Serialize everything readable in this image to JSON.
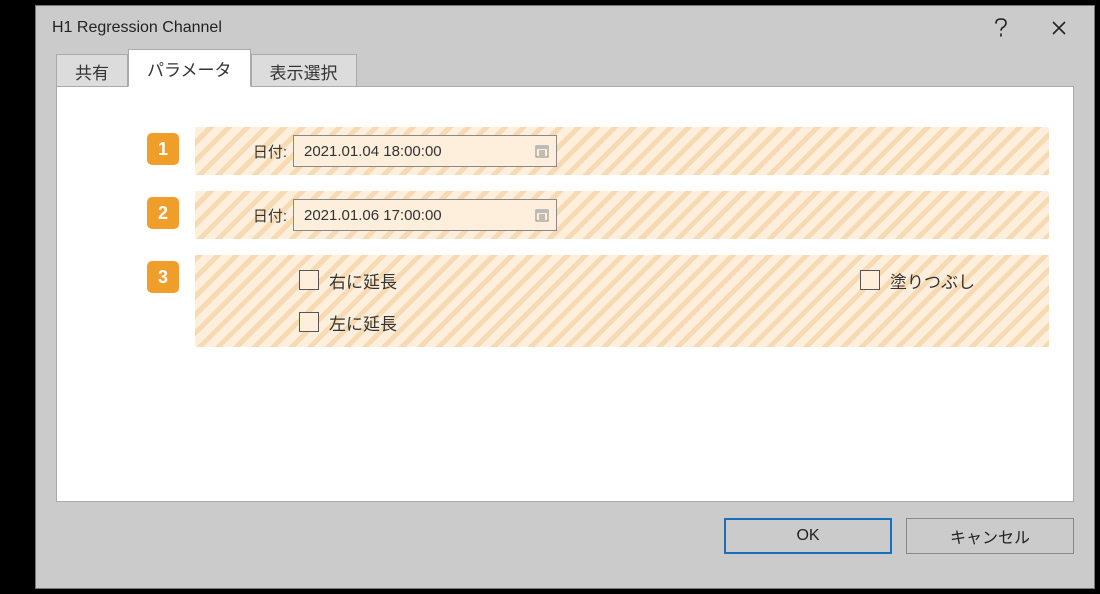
{
  "window": {
    "title": "H1 Regression Channel"
  },
  "tabs": {
    "share": "共有",
    "parameters": "パラメータ",
    "display": "表示選択"
  },
  "rows": {
    "r1": {
      "marker": "1",
      "label": "日付:",
      "value": "2021.01.04 18:00:00"
    },
    "r2": {
      "marker": "2",
      "label": "日付:",
      "value": "2021.01.06 17:00:00"
    },
    "r3": {
      "marker": "3",
      "extend_right": "右に延長",
      "extend_left": "左に延長",
      "fill": "塗りつぶし"
    }
  },
  "buttons": {
    "ok": "OK",
    "cancel": "キャンセル"
  }
}
